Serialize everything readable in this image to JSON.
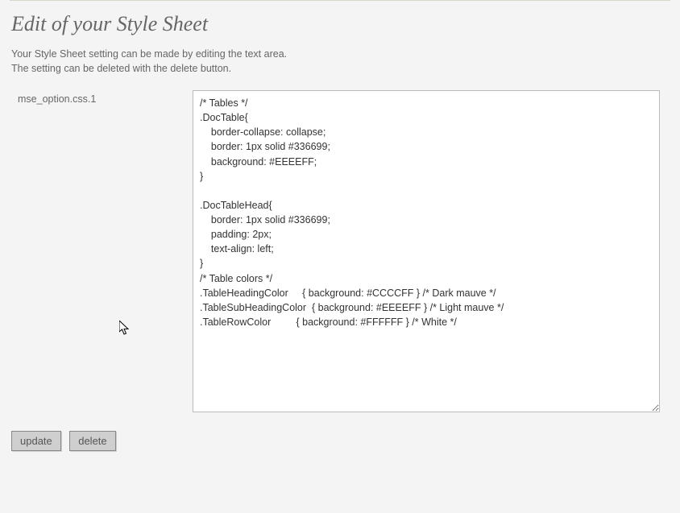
{
  "title": "Edit of your Style Sheet",
  "intro_line1": "Your Style Sheet setting can be made by editing the text area.",
  "intro_line2": "The setting can be deleted with the delete button.",
  "field": {
    "label": "mse_option.css.1",
    "value": "/* Tables */\n.DocTable{\n    border-collapse: collapse;\n    border: 1px solid #336699;\n    background: #EEEEFF;\n}\n\n.DocTableHead{\n    border: 1px solid #336699;\n    padding: 2px;\n    text-align: left;\n}\n/* Table colors */\n.TableHeadingColor     { background: #CCCCFF } /* Dark mauve */\n.TableSubHeadingColor  { background: #EEEEFF } /* Light mauve */\n.TableRowColor         { background: #FFFFFF } /* White */"
  },
  "buttons": {
    "update": "update",
    "delete": "delete"
  }
}
